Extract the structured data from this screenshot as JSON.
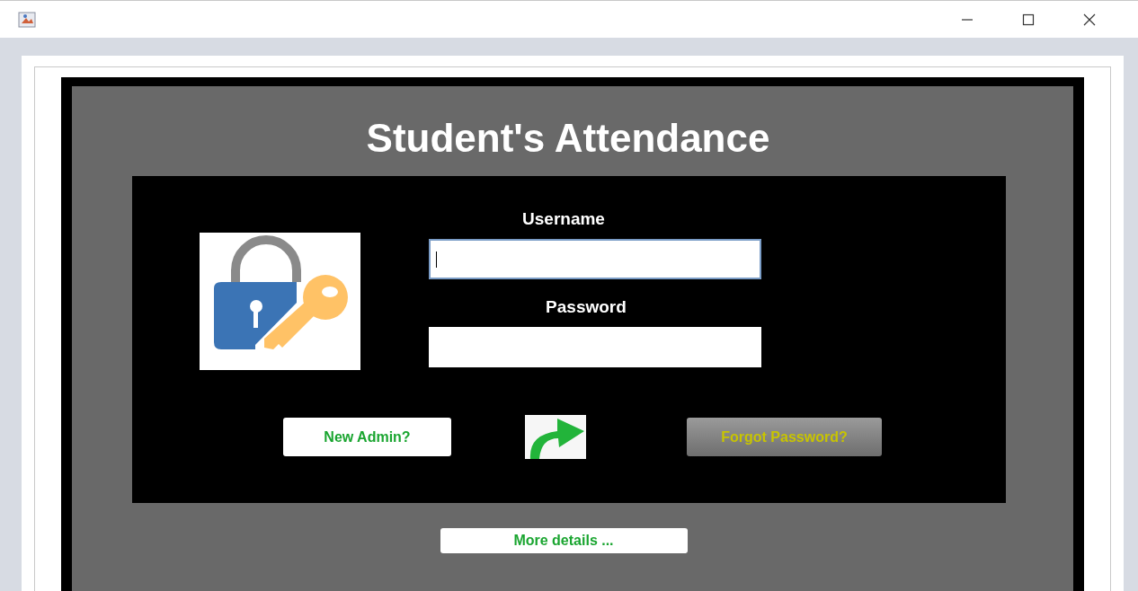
{
  "title": "Student's Attendance",
  "fields": [
    {
      "label": "Username",
      "focused": true
    },
    {
      "label": "Password",
      "focused": false
    }
  ],
  "buttons": [
    {
      "label": "New Admin?",
      "kind": "light"
    },
    {
      "label": "Forgot Password?",
      "kind": "dark"
    }
  ],
  "more_button": "More details ..."
}
